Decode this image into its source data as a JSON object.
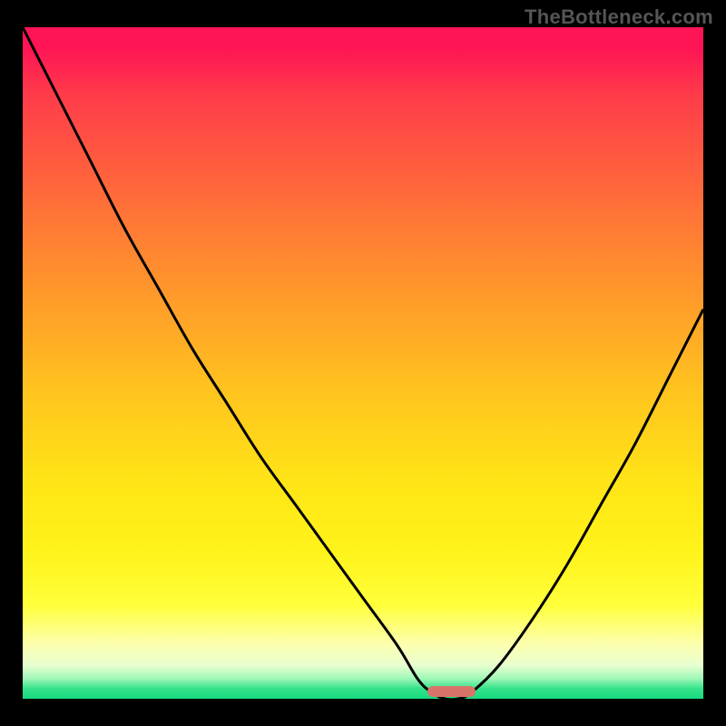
{
  "watermark": "TheBottleneck.com",
  "colors": {
    "line": "#000000",
    "marker": "#d9736a",
    "gradient_top": "#ff1455",
    "gradient_bottom": "#17d980"
  },
  "chart_data": {
    "type": "line",
    "title": "",
    "xlabel": "",
    "ylabel": "",
    "xlim": [
      0,
      100
    ],
    "ylim": [
      0,
      100
    ],
    "x": [
      0,
      5,
      10,
      15,
      20,
      25,
      30,
      35,
      40,
      45,
      50,
      55,
      58,
      60,
      62,
      64,
      66,
      70,
      75,
      80,
      85,
      90,
      95,
      100
    ],
    "values": [
      100,
      90,
      80,
      70,
      61,
      52,
      44,
      36,
      29,
      22,
      15,
      8,
      3,
      1,
      0,
      0,
      1,
      5,
      12,
      20,
      29,
      38,
      48,
      58
    ],
    "minimum_at_x": 63,
    "marker": {
      "x_center": 63,
      "y": 0,
      "width_pct": 7
    }
  }
}
